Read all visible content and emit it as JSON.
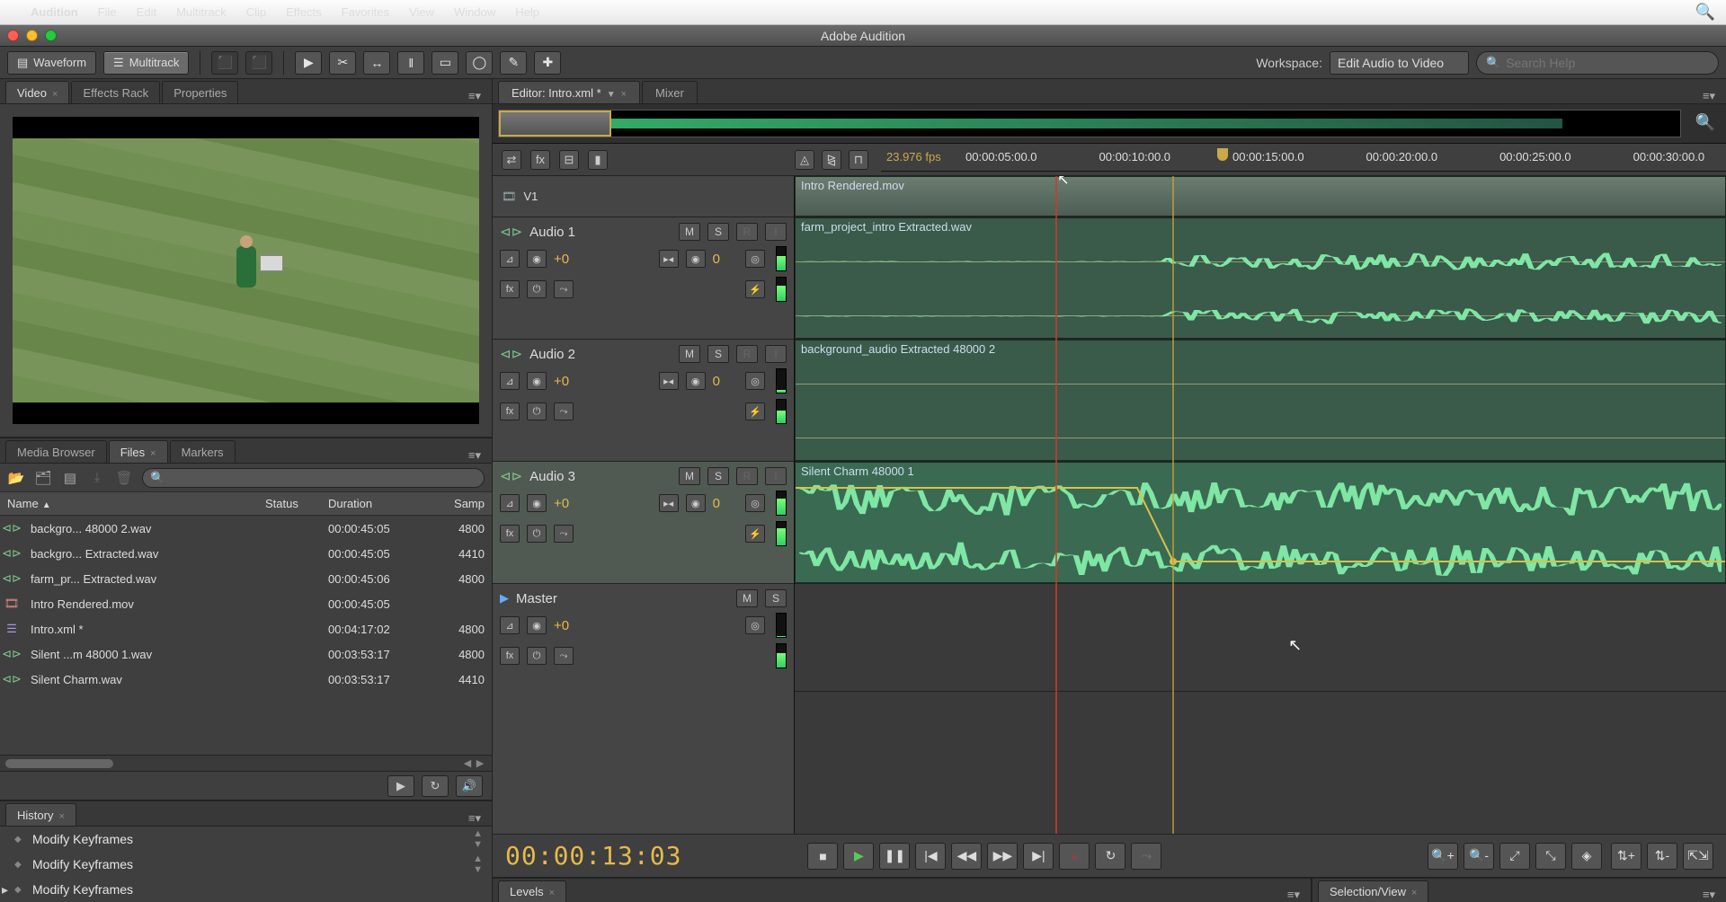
{
  "mac_menu": {
    "app": "Audition",
    "items": [
      "File",
      "Edit",
      "Multitrack",
      "Clip",
      "Effects",
      "Favorites",
      "View",
      "Window",
      "Help"
    ]
  },
  "window_title": "Adobe Audition",
  "toolbar": {
    "waveform": "Waveform",
    "multitrack": "Multitrack",
    "workspace_label": "Workspace:",
    "workspace_value": "Edit Audio to Video",
    "search_placeholder": "Search Help"
  },
  "left_panels": {
    "video_tab": "Video",
    "effects_tab": "Effects Rack",
    "properties_tab": "Properties",
    "media_browser_tab": "Media Browser",
    "files_tab": "Files",
    "markers_tab": "Markers",
    "history_tab": "History"
  },
  "file_columns": {
    "name": "Name",
    "status": "Status",
    "duration": "Duration",
    "sample": "Samp"
  },
  "files": [
    {
      "icon": "aud",
      "name": "backgro... 48000 2.wav",
      "status": "",
      "duration": "00:00:45:05",
      "sample": "4800"
    },
    {
      "icon": "aud",
      "name": "backgro... Extracted.wav",
      "status": "",
      "duration": "00:00:45:05",
      "sample": "4410"
    },
    {
      "icon": "aud",
      "name": "farm_pr... Extracted.wav",
      "status": "",
      "duration": "00:00:45:06",
      "sample": "4800"
    },
    {
      "icon": "vid",
      "name": "Intro Rendered.mov",
      "status": "",
      "duration": "00:00:45:05",
      "sample": ""
    },
    {
      "icon": "xml",
      "name": "Intro.xml *",
      "status": "",
      "duration": "00:04:17:02",
      "sample": "4800"
    },
    {
      "icon": "aud",
      "name": "Silent ...m 48000 1.wav",
      "status": "",
      "duration": "00:03:53:17",
      "sample": "4800"
    },
    {
      "icon": "aud",
      "name": "Silent Charm.wav",
      "status": "",
      "duration": "00:03:53:17",
      "sample": "4410"
    }
  ],
  "history": [
    "Modify Keyframes",
    "Modify Keyframes",
    "Modify Keyframes"
  ],
  "editor": {
    "tab": "Editor: Intro.xml *",
    "mixer_tab": "Mixer",
    "fps": "23.976 fps",
    "ticks": [
      "00:00:05:00.0",
      "00:00:10:00.0",
      "00:00:15:00.0",
      "00:00:20:00.0",
      "00:00:25:00.0",
      "00:00:30:00.0"
    ],
    "video_track": "V1",
    "tracks": [
      {
        "name": "Audio 1",
        "gain": "+0",
        "pan": "0"
      },
      {
        "name": "Audio 2",
        "gain": "+0",
        "pan": "0"
      },
      {
        "name": "Audio 3",
        "gain": "+0",
        "pan": "0"
      }
    ],
    "master": {
      "name": "Master",
      "gain": "+0"
    },
    "btn_m": "M",
    "btn_s": "S",
    "btn_r": "R",
    "btn_i": "I",
    "clips": {
      "video": "Intro Rendered.mov",
      "a1": "farm_project_intro Extracted.wav",
      "a2": "background_audio Extracted 48000 2",
      "a3": "Silent Charm 48000 1"
    },
    "timecode": "00:00:13:03"
  },
  "bottom": {
    "levels": "Levels",
    "selection": "Selection/View"
  }
}
